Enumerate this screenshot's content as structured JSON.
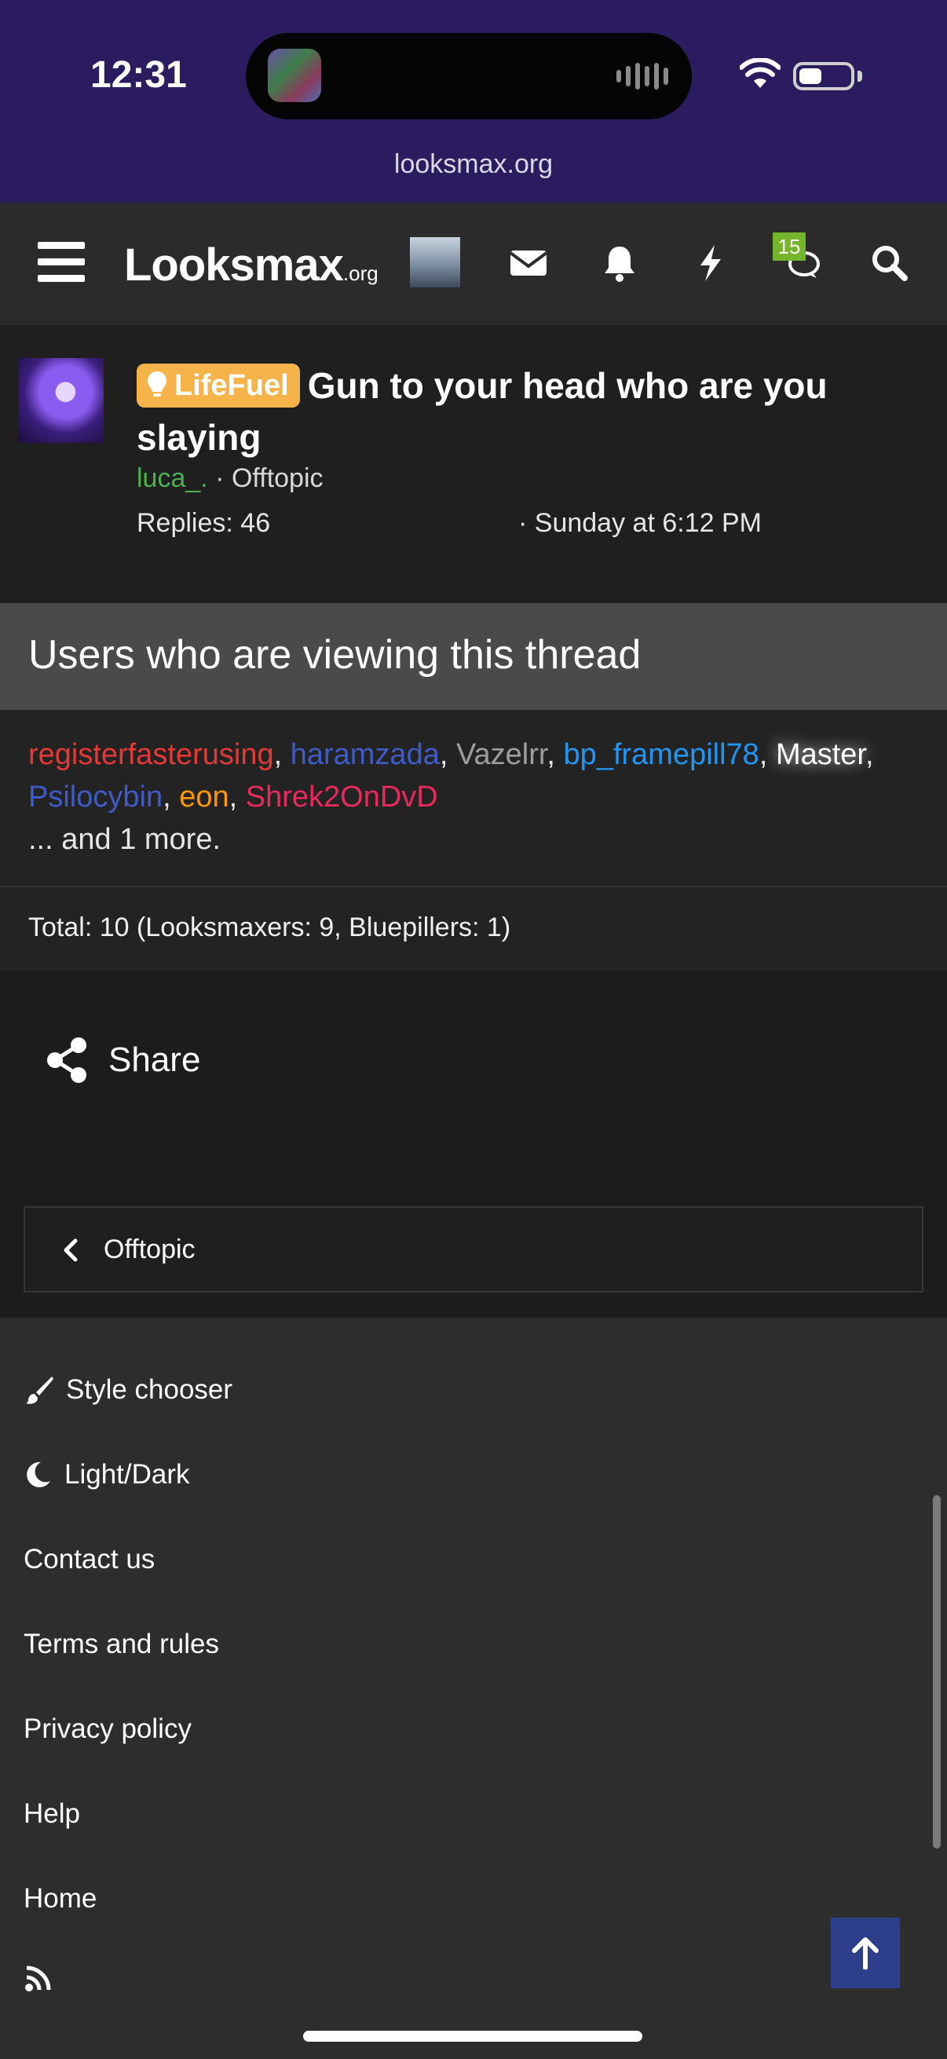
{
  "status_bar": {
    "time": "12:31",
    "url": "looksmax.org",
    "battery_level": 0.45
  },
  "nav": {
    "logo": "Looksmax",
    "logo_suffix": ".org",
    "conversations_badge": "15"
  },
  "thread": {
    "prefix": "LifeFuel",
    "title": "Gun to your head who are you slaying",
    "author": "luca_.",
    "forum": "Offtopic",
    "replies": "Replies: 46",
    "date": "Sunday at 6:12 PM"
  },
  "viewing": {
    "header": "Users who are viewing this thread",
    "users": [
      "registerfasterusing",
      "haramzada",
      "Vazelrr",
      "bp_framepill78",
      "Master",
      "Psilocybin",
      "eon",
      "Shrek2OnDvD"
    ],
    "more": "... and 1 more.",
    "total": "Total: 10 (Looksmaxers: 9, Bluepillers: 1)"
  },
  "share": {
    "label": "Share"
  },
  "breadcrumb": {
    "label": "Offtopic"
  },
  "footer": {
    "items": [
      "Style chooser",
      "Light/Dark",
      "Contact us",
      "Terms and rules",
      "Privacy policy",
      "Help",
      "Home"
    ]
  }
}
